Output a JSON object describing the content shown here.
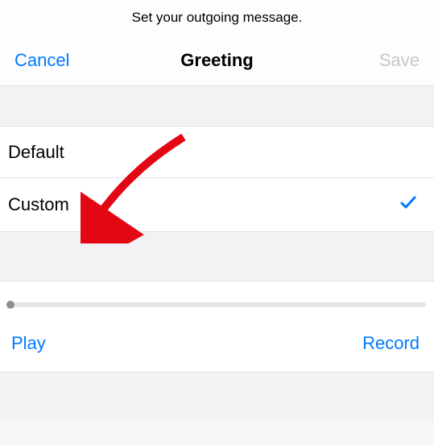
{
  "instruction": "Set your outgoing message.",
  "nav": {
    "cancel": "Cancel",
    "title": "Greeting",
    "save": "Save"
  },
  "options": {
    "default_label": "Default",
    "custom_label": "Custom",
    "selected": "custom"
  },
  "actions": {
    "play": "Play",
    "record": "Record"
  },
  "colors": {
    "accent": "#007aff",
    "disabled": "#c7c7cc"
  },
  "annotation": {
    "arrow_points_to": "custom-option"
  }
}
